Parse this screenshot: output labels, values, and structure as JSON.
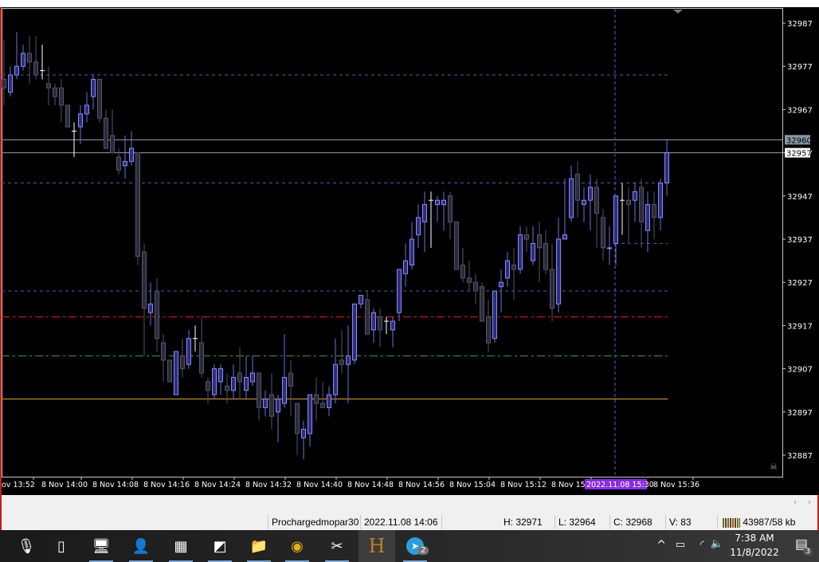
{
  "window": {
    "accent_border": "#c02020"
  },
  "chart_data": {
    "type": "candlestick",
    "symbol_timeframe": "M1",
    "price_axis": {
      "min": 32887,
      "max": 32987,
      "ticks": [
        "32987",
        "32977",
        "32967",
        "32957",
        "32947",
        "32937",
        "32927",
        "32917",
        "32907",
        "32897",
        "32887"
      ]
    },
    "price_labels": [
      {
        "value": "32960",
        "bg": "#8a96a6",
        "fg": "#000"
      },
      {
        "value": "32957",
        "bg": "#ffffff",
        "fg": "#000"
      }
    ],
    "time_labels": [
      "ov 13:52",
      "8 Nov 14:00",
      "8 Nov 14:08",
      "8 Nov 14:16",
      "8 Nov 14:24",
      "8 Nov 14:32",
      "8 Nov 14:40",
      "8 Nov 14:48",
      "8 Nov 14:56",
      "8 Nov 15:04",
      "8 Nov 15:12",
      "8 Nov 15:",
      "8 Nov 15:36"
    ],
    "crosshair_time_label": "2022.11.08 15:30",
    "colors": {
      "bull_body": "#2e2e78",
      "bull_border": "#8a8aff",
      "bear_body": "#2a2a3a",
      "bear_border": "#55556e",
      "wick": "#7070e0",
      "doji": "#ffffff",
      "background": "#000000"
    },
    "levels": [
      {
        "price": 32960,
        "style": "solid",
        "color": "#9aa0aa"
      },
      {
        "price": 32957,
        "style": "solid",
        "color": "#9aa0aa"
      },
      {
        "price": 32975,
        "style": "dashed",
        "color": "#5a5aa8"
      },
      {
        "price": 32950,
        "style": "dashed",
        "color": "#5a5aa8"
      },
      {
        "price": 32925,
        "style": "dashed",
        "color": "#5a5aa8"
      },
      {
        "price": 32936,
        "style": "dashed-short",
        "color": "#5a5aa8"
      },
      {
        "price": 32919,
        "style": "dashdot",
        "color": "#e02020"
      },
      {
        "price": 32910,
        "style": "dashdot",
        "color": "#40a040"
      },
      {
        "price": 32900,
        "style": "solid",
        "color": "#e0a040"
      }
    ],
    "candles_ohlc": [
      [
        32974,
        32983,
        32968,
        32972
      ],
      [
        32971,
        32977,
        32970,
        32975
      ],
      [
        32975,
        32985,
        32974,
        32977
      ],
      [
        32977,
        32982,
        32976,
        32980
      ],
      [
        32980,
        32984,
        32973,
        32978
      ],
      [
        32978,
        32984,
        32974,
        32975
      ],
      [
        32976,
        32982,
        32974,
        32976
      ],
      [
        32973,
        32977,
        32968,
        32972
      ],
      [
        32972,
        32973,
        32968,
        32970
      ],
      [
        32972,
        32974,
        32964,
        32968
      ],
      [
        32968,
        32968,
        32963,
        32963
      ],
      [
        32962,
        32964,
        32956,
        32962
      ],
      [
        32963,
        32968,
        32959,
        32966
      ],
      [
        32966,
        32971,
        32964,
        32968
      ],
      [
        32970,
        32975,
        32967,
        32974
      ],
      [
        32974,
        32974,
        32964,
        32965
      ],
      [
        32965,
        32967,
        32959,
        32958
      ],
      [
        32961,
        32967,
        32957,
        32957
      ],
      [
        32956,
        32958,
        32952,
        32953
      ],
      [
        32954,
        32961,
        32951,
        32955
      ],
      [
        32955,
        32962,
        32954,
        32958
      ],
      [
        32957,
        32957,
        32931,
        32933
      ],
      [
        32934,
        32936,
        32910,
        32921
      ],
      [
        32920,
        32927,
        32917,
        32922
      ],
      [
        32925,
        32928,
        32911,
        32914
      ],
      [
        32913,
        32915,
        32904,
        32909
      ],
      [
        32909,
        32909,
        32904,
        32904
      ],
      [
        32901,
        32911,
        32901,
        32911
      ],
      [
        32910,
        32914,
        32905,
        32907
      ],
      [
        32908,
        32916,
        32907,
        32914
      ],
      [
        32914,
        32917,
        32911,
        32914
      ],
      [
        32913,
        32919,
        32905,
        32906
      ],
      [
        32904,
        32905,
        32899,
        32902
      ],
      [
        32901,
        32908,
        32900,
        32907
      ],
      [
        32904,
        32908,
        32901,
        32907
      ],
      [
        32903,
        32906,
        32899,
        32902
      ],
      [
        32902,
        32908,
        32900,
        32905
      ],
      [
        32906,
        32912,
        32900,
        32904
      ],
      [
        32902,
        32910,
        32900,
        32905
      ],
      [
        32904,
        32910,
        32903,
        32906
      ],
      [
        32906,
        32906,
        32895,
        32898
      ],
      [
        32898,
        32902,
        32896,
        32900
      ],
      [
        32901,
        32906,
        32893,
        32896
      ],
      [
        32897,
        32901,
        32890,
        32900
      ],
      [
        32899,
        32915,
        32898,
        32905
      ],
      [
        32906,
        32909,
        32896,
        32903
      ],
      [
        32899,
        32899,
        32887,
        32892
      ],
      [
        32891,
        32895,
        32886,
        32893
      ],
      [
        32892,
        32901,
        32889,
        32901
      ],
      [
        32901,
        32905,
        32895,
        32899
      ],
      [
        32899,
        32904,
        32898,
        32898
      ],
      [
        32898,
        32903,
        32896,
        32901
      ],
      [
        32901,
        32914,
        32899,
        32908
      ],
      [
        32909,
        32916,
        32906,
        32908
      ],
      [
        32908,
        32917,
        32899,
        32910
      ],
      [
        32909,
        32922,
        32908,
        32922
      ],
      [
        32922,
        32924,
        32921,
        32924
      ],
      [
        32923,
        32925,
        32915,
        32915
      ],
      [
        32916,
        32921,
        32913,
        32920
      ],
      [
        32919,
        32921,
        32912,
        32916
      ],
      [
        32918,
        32919,
        32915,
        32918
      ],
      [
        32916,
        32919,
        32912,
        32918
      ],
      [
        32920,
        32930,
        32918,
        32930
      ],
      [
        32929,
        32936,
        32926,
        32932
      ],
      [
        32931,
        32941,
        32930,
        32937
      ],
      [
        32938,
        32945,
        32935,
        32942
      ],
      [
        32941,
        32948,
        32934,
        32945
      ],
      [
        32946,
        32948,
        32935,
        32946
      ],
      [
        32945,
        32947,
        32941,
        32946
      ],
      [
        32945,
        32948,
        32939,
        32946
      ],
      [
        32947,
        32948,
        32937,
        32941
      ],
      [
        32941,
        32941,
        32930,
        32930
      ],
      [
        32931,
        32935,
        32927,
        32928
      ],
      [
        32928,
        32932,
        32925,
        32927
      ],
      [
        32927,
        32929,
        32922,
        32925
      ],
      [
        32926,
        32927,
        32918,
        32918
      ],
      [
        32919,
        32923,
        32911,
        32913
      ],
      [
        32914,
        32925,
        32913,
        32925
      ],
      [
        32926,
        32930,
        32920,
        32927
      ],
      [
        32928,
        32934,
        32926,
        32932
      ],
      [
        32931,
        32935,
        32923,
        32930
      ],
      [
        32930,
        32940,
        32929,
        32938
      ],
      [
        32938,
        32940,
        32934,
        32937
      ],
      [
        32932,
        32940,
        32931,
        32936
      ],
      [
        32938,
        32941,
        32927,
        32935
      ],
      [
        32936,
        32939,
        32929,
        32930
      ],
      [
        32930,
        32936,
        32918,
        32921
      ],
      [
        32922,
        32942,
        32920,
        32937
      ],
      [
        32937,
        32951,
        32937,
        32938
      ],
      [
        32942,
        32954,
        32941,
        32951
      ],
      [
        32952,
        32955,
        32942,
        32946
      ],
      [
        32945,
        32949,
        32941,
        32946
      ],
      [
        32946,
        32952,
        32939,
        32949
      ],
      [
        32949,
        32951,
        32935,
        32943
      ],
      [
        32942,
        32944,
        32932,
        32935
      ],
      [
        32935,
        32940,
        32931,
        32935
      ],
      [
        32936,
        32947,
        32931,
        32947
      ],
      [
        32946,
        32950,
        32938,
        32948
      ],
      [
        32946,
        32949,
        32936,
        32945
      ],
      [
        32946,
        32950,
        32941,
        32948
      ],
      [
        32949,
        32951,
        32935,
        32941
      ],
      [
        32939,
        32948,
        32934,
        32945
      ],
      [
        32945,
        32948,
        32937,
        32942
      ],
      [
        32942,
        32951,
        32939,
        32950
      ],
      [
        32950,
        32960,
        32947,
        32957
      ]
    ],
    "doji_indices": [
      6,
      11,
      30,
      60,
      67,
      97
    ],
    "crosshair_candle_index": 96
  },
  "statusbar": {
    "profile": "Prochargedmopar30",
    "datetime": "2022.11.08 14:06",
    "high": "H: 32971",
    "low": "L: 32964",
    "close": "C: 32968",
    "volume": "V: 83",
    "traffic": "43987/58 kb"
  },
  "taskbar": {
    "apps": [
      {
        "name": "microphone-icon",
        "glyph": "🎙"
      },
      {
        "name": "task-view-icon",
        "glyph": "▯"
      },
      {
        "name": "computer-icon",
        "glyph": "🖥"
      },
      {
        "name": "user-app-icon",
        "glyph": "👤"
      },
      {
        "name": "calculator-icon",
        "glyph": "▦"
      },
      {
        "name": "notes-icon",
        "glyph": "◩"
      },
      {
        "name": "file-explorer-icon",
        "glyph": "📁"
      },
      {
        "name": "chrome-icon",
        "glyph": "◉"
      },
      {
        "name": "snipping-tool-icon",
        "glyph": "✂"
      },
      {
        "name": "trading-terminal-icon",
        "glyph": "H"
      },
      {
        "name": "telegram-icon",
        "glyph": "➤"
      }
    ],
    "telegram_badge": "2",
    "time": "7:38 AM",
    "date": "11/8/2022",
    "notification_count": "3"
  }
}
